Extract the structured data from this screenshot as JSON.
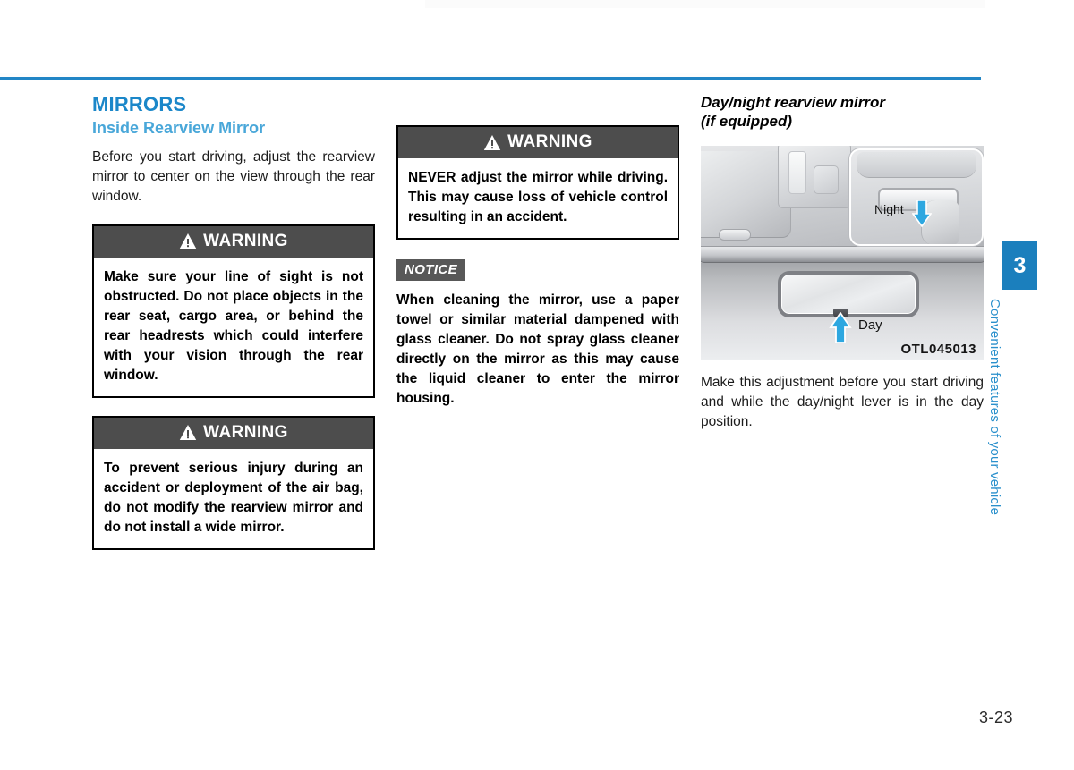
{
  "page": {
    "number": "3-23",
    "accent_color": "#1b87c9",
    "subheading_color": "#49a7d9",
    "tab_color": "#1b7fbd"
  },
  "tab": {
    "chapter_number": "3",
    "chapter_title": "Convenient features of your vehicle"
  },
  "column_left": {
    "section_heading": "MIRRORS",
    "sub_heading": "Inside Rearview Mirror",
    "intro_paragraph": "Before you start driving, adjust the rearview mirror to center on the view through the rear window.",
    "warning_1": {
      "label": "WARNING",
      "body": "Make sure your line of sight is not obstructed. Do not place objects in the rear seat, cargo area, or behind the rear headrests which could interfere with your vision through the rear window."
    },
    "warning_2": {
      "label": "WARNING",
      "body": "To prevent serious injury during an accident or deployment of the air bag, do not modify the rearview mirror and do not install a wide mirror."
    }
  },
  "column_middle": {
    "warning_3": {
      "label": "WARNING",
      "body": "NEVER adjust the mirror while driving. This may cause loss of vehicle control resulting in an accident."
    },
    "notice": {
      "label": "NOTICE",
      "body": "When cleaning the mirror, use a paper towel or similar material dampened with glass cleaner. Do not spray glass cleaner directly on the mirror as this may cause the liquid cleaner to enter the mirror housing."
    }
  },
  "column_right": {
    "heading_line_1": "Day/night rearview mirror",
    "heading_line_2": "(if equipped)",
    "illustration": {
      "night_label": "Night",
      "day_label": "Day",
      "figure_code": "OTL045013",
      "arrow_color": "#2da7e0"
    },
    "caption": "Make this adjustment before you start driving and while the day/night lever is in the day position."
  }
}
